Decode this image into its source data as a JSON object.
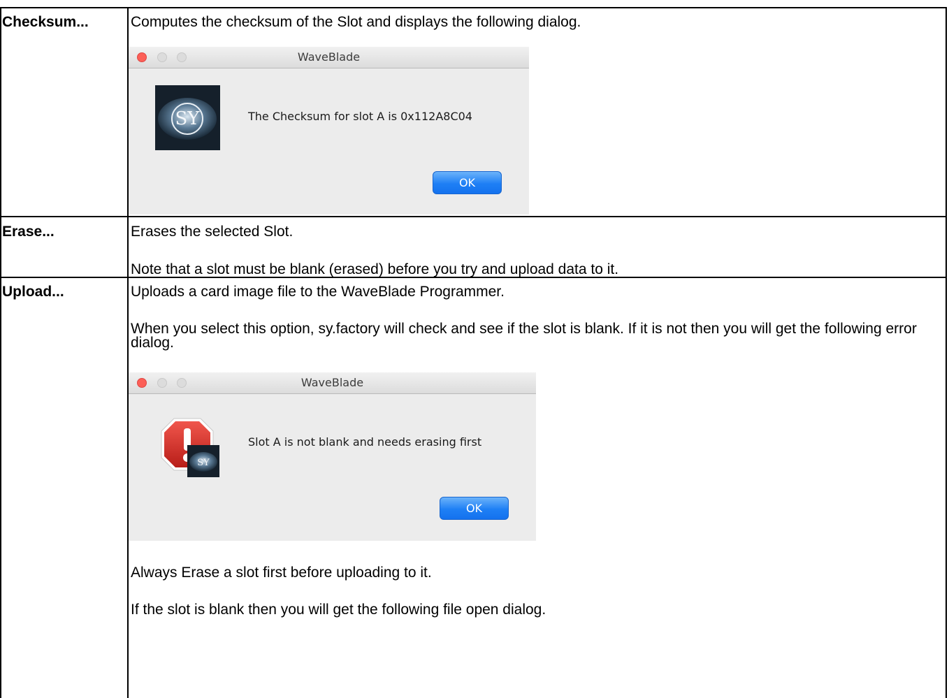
{
  "rows": [
    {
      "command": "Checksum...",
      "paragraphs": [
        "Computes the checksum of the Slot and displays the following dialog."
      ],
      "dialog": {
        "title": "WaveBlade",
        "message": "The Checksum for slot A is 0x112A8C04",
        "ok_label": "OK",
        "icon": "sy-logo-icon"
      }
    },
    {
      "command": "Erase...",
      "paragraphs": [
        "Erases the selected Slot.",
        "Note that a slot must be blank (erased) before you try and upload data to it."
      ]
    },
    {
      "command": "Upload...",
      "paragraphs": [
        "Uploads a card image file to the WaveBlade Programmer.",
        "When you select this option, sy.factory will check and see if the slot is blank. If it is not then you will get the following error dialog.",
        "Always Erase a slot first before uploading to it.",
        "If the slot is blank then you will get the following file open dialog."
      ],
      "dialog": {
        "title": "WaveBlade",
        "message": "Slot A is not blank and needs erasing first",
        "ok_label": "OK",
        "icon": "stop-warning-icon"
      }
    }
  ],
  "colors": {
    "dialog_bg": "#ececec",
    "ok_button": "#1e7ff5",
    "close_button": "#fc5f57",
    "warning_red": "#d9302a"
  }
}
